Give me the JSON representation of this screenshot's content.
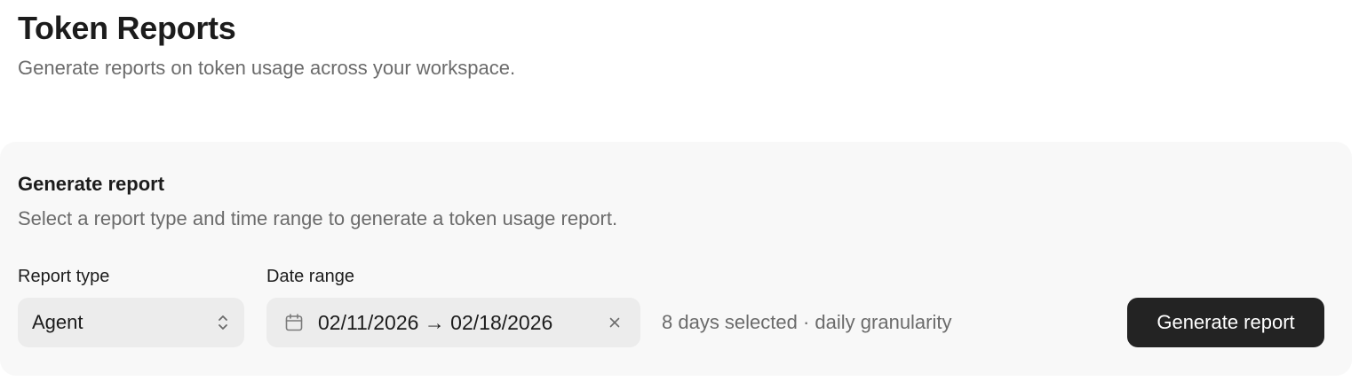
{
  "header": {
    "title": "Token Reports",
    "subtitle": "Generate reports on token usage across your workspace."
  },
  "panel": {
    "title": "Generate report",
    "description": "Select a report type and time range to generate a token usage report.",
    "report_type": {
      "label": "Report type",
      "selected": "Agent",
      "icon": "chevron-up-down-icon"
    },
    "date_range": {
      "label": "Date range",
      "value": "02/11/2026 → 02/18/2026",
      "icon": "calendar-icon",
      "clear_icon": "close-icon"
    },
    "range_info": "8 days selected · daily granularity",
    "generate_button": "Generate report"
  },
  "colors": {
    "panel_background": "#f8f8f8",
    "field_background": "#ececec",
    "button_background": "#232323",
    "muted_text": "#6b6b6b"
  }
}
